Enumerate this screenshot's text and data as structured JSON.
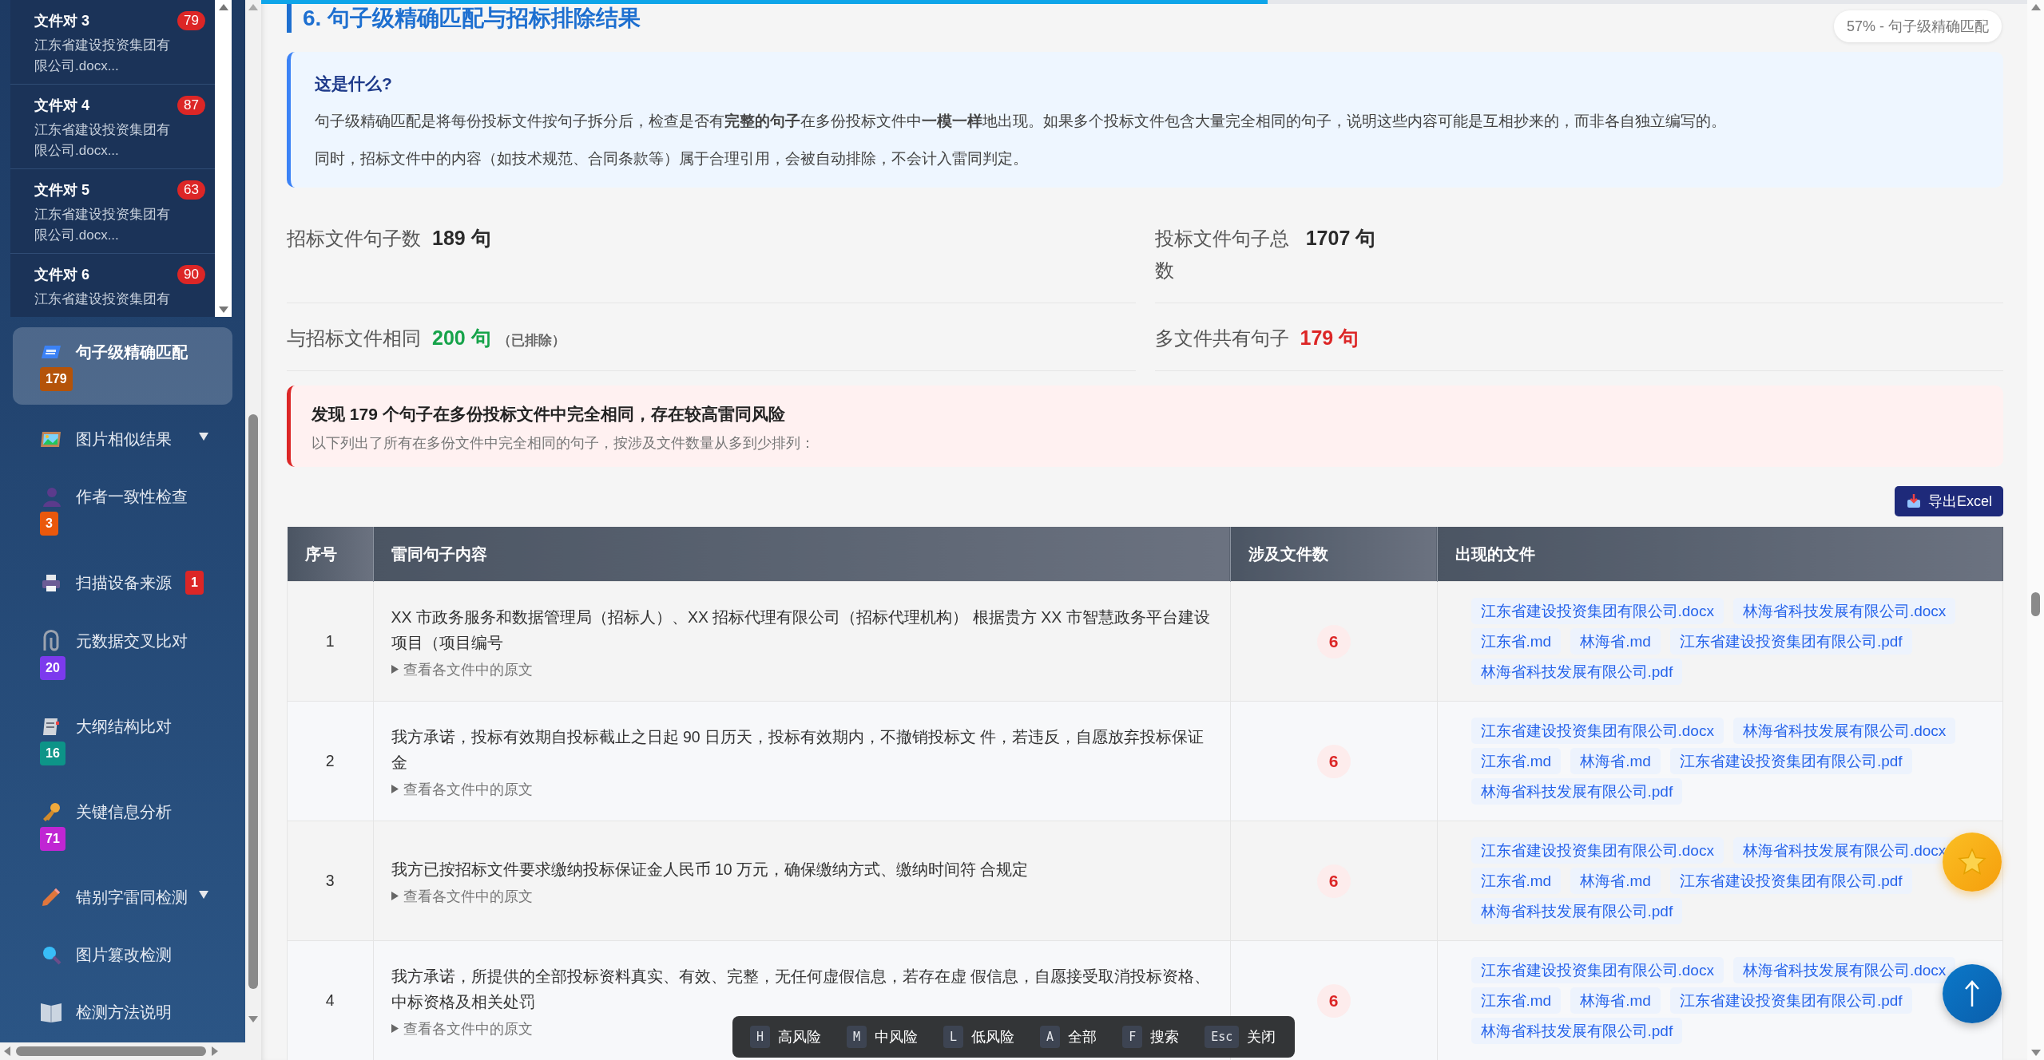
{
  "sidebar": {
    "file_pairs": [
      {
        "title": "文件对 3",
        "subtitle": "江东省建设投资集团有限公司.docx...",
        "count": "79"
      },
      {
        "title": "文件对 4",
        "subtitle": "江东省建设投资集团有限公司.docx...",
        "count": "87"
      },
      {
        "title": "文件对 5",
        "subtitle": "江东省建设投资集团有限公司.docx...",
        "count": "63"
      },
      {
        "title": "文件对 6",
        "subtitle": "江东省建设投资集团有",
        "count": "90"
      }
    ],
    "nav": [
      {
        "label": "句子级精确匹配",
        "selected": true,
        "has_submenu": false,
        "badge": "179",
        "color": "#b45309"
      },
      {
        "label": "图片相似结果",
        "selected": false,
        "has_submenu": true
      },
      {
        "label": "作者一致性检查",
        "selected": false,
        "has_submenu": false,
        "badge": "3",
        "color": "#ea580c"
      },
      {
        "label": "扫描设备来源",
        "selected": false,
        "has_submenu": false,
        "badge": "1",
        "color": "#dc2626"
      },
      {
        "label": "元数据交叉比对",
        "selected": false,
        "has_submenu": false,
        "badge": "20",
        "color": "#7c3aed"
      },
      {
        "label": "大纲结构比对",
        "selected": false,
        "has_submenu": false,
        "badge": "16",
        "color": "#0d9488"
      },
      {
        "label": "关键信息分析",
        "selected": false,
        "has_submenu": false,
        "badge": "71",
        "color": "#c026d3"
      },
      {
        "label": "错别字雷同检测",
        "selected": false,
        "has_submenu": true
      },
      {
        "label": "图片篡改检测",
        "selected": false,
        "has_submenu": false
      },
      {
        "label": "检测方法说明",
        "selected": false,
        "has_submenu": false
      }
    ]
  },
  "progress": {
    "level": 0.57,
    "label": "57% - 句子级精确匹配"
  },
  "section_title": "6. 句子级精确匹配与招标排除结果",
  "info": {
    "heading": "这是什么?",
    "paragraphs": [
      "句子级精确匹配是将每份投标文件按句子拆分后，检查是否有**完整的句子**在多份投标文件中**一模一样**地出现。如果多个投标文件包含大量完全相同的句子，说明这些内容可能是互相抄来的，而非各自独立编写的。",
      "同时，招标文件中的内容（如技术规范、合同条款等）属于合理引用，会被自动排除，不会计入雷同判定。"
    ]
  },
  "stats": [
    {
      "label": "招标文件句子数",
      "value": "189 句",
      "color": "#2b2b2b"
    },
    {
      "label": "投标文件句子总数",
      "value": "1707 句",
      "color": "#2b2b2b"
    },
    {
      "label": "与招标文件相同",
      "value": "200 句",
      "color": "#16a34a",
      "note": "（已排除）"
    },
    {
      "label": "多文件共有句子",
      "value": "179 句",
      "color": "#dc2626"
    }
  ],
  "alert": {
    "heading": "发现 179 个句子在多份投标文件中完全相同，存在较高雷同风险",
    "text": "以下列出了所有在多份文件中完全相同的句子，按涉及文件数量从多到少排列："
  },
  "export_button": "导出Excel",
  "table": {
    "columns": [
      "序号",
      "雷同句子内容",
      "涉及文件数",
      "出现的文件"
    ],
    "rows": [
      {
        "index": "1",
        "sentence": "XX 市政务服务和数据管理局（招标人）、XX 招标代理有限公司（招标代理机构） 根据贵方 XX 市智慧政务平台建设项目（项目编号",
        "toggle": "查看各文件中的原文",
        "file_count": "6",
        "files": [
          "江东省建设投资集团有限公司.docx",
          "林海省科技发展有限公司.docx",
          "江东省.md",
          "林海省.md",
          "江东省建设投资集团有限公司.pdf",
          "林海省科技发展有限公司.pdf"
        ]
      },
      {
        "index": "2",
        "sentence": "我方承诺，投标有效期自投标截止之日起 90 日历天，投标有效期内，不撤销投标文 件，若违反，自愿放弃投标保证金",
        "toggle": "查看各文件中的原文",
        "file_count": "6",
        "files": [
          "江东省建设投资集团有限公司.docx",
          "林海省科技发展有限公司.docx",
          "江东省.md",
          "林海省.md",
          "江东省建设投资集团有限公司.pdf",
          "林海省科技发展有限公司.pdf"
        ]
      },
      {
        "index": "3",
        "sentence": "我方已按招标文件要求缴纳投标保证金人民币 10 万元，确保缴纳方式、缴纳时间符 合规定",
        "toggle": "查看各文件中的原文",
        "file_count": "6",
        "files": [
          "江东省建设投资集团有限公司.docx",
          "林海省科技发展有限公司.docx",
          "江东省.md",
          "林海省.md",
          "江东省建设投资集团有限公司.pdf",
          "林海省科技发展有限公司.pdf"
        ]
      },
      {
        "index": "4",
        "sentence": "我方承诺，所提供的全部投标资料真实、有效、完整，无任何虚假信息，若存在虚 假信息，自愿接受取消投标资格、中标资格及相关处罚",
        "toggle": "查看各文件中的原文",
        "file_count": "6",
        "files": [
          "江东省建设投资集团有限公司.docx",
          "林海省科技发展有限公司.docx",
          "江东省.md",
          "林海省.md",
          "江东省建设投资集团有限公司.pdf",
          "林海省科技发展有限公司.pdf"
        ]
      }
    ]
  },
  "shortcuts": [
    {
      "key": "H",
      "label": "高风险"
    },
    {
      "key": "M",
      "label": "中风险"
    },
    {
      "key": "L",
      "label": "低风险"
    },
    {
      "key": "A",
      "label": "全部"
    },
    {
      "key": "F",
      "label": "搜索"
    },
    {
      "key": "Esc",
      "label": "关闭"
    }
  ]
}
